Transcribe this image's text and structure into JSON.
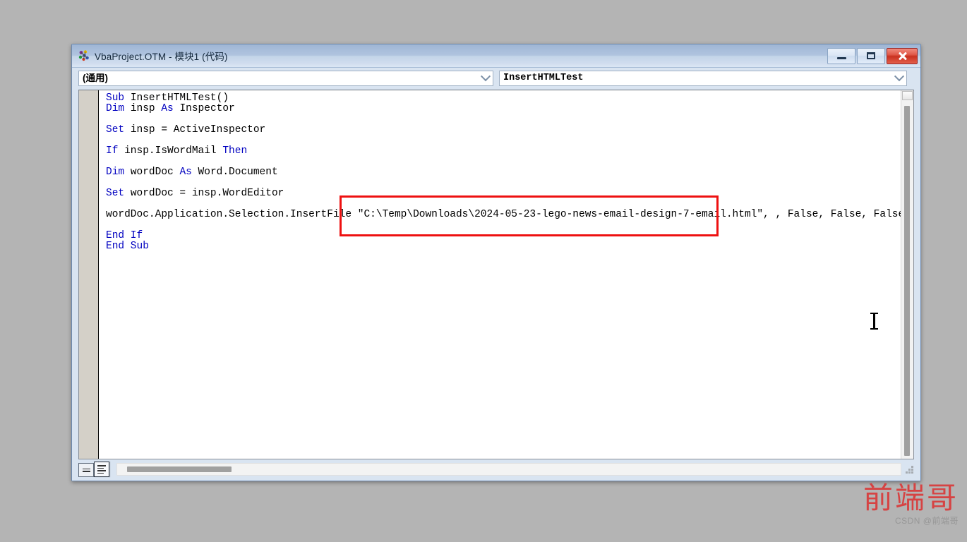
{
  "window": {
    "title": "VbaProject.OTM - 模块1 (代码)",
    "icon": "vba-project-icon",
    "buttons": {
      "minimize": "minimize-icon",
      "maximize": "maximize-icon",
      "close": "close-icon"
    }
  },
  "toolbars": {
    "object_combo": {
      "value": "(通用)",
      "arrow": "chevron-down-icon"
    },
    "procedure_combo": {
      "value": "InsertHTMLTest",
      "arrow": "chevron-down-icon"
    }
  },
  "code": {
    "lines": [
      [
        {
          "t": "Sub ",
          "k": true
        },
        {
          "t": "InsertHTMLTest()",
          "k": false
        }
      ],
      [
        {
          "t": "Dim ",
          "k": true
        },
        {
          "t": "insp ",
          "k": false
        },
        {
          "t": "As ",
          "k": true
        },
        {
          "t": "Inspector",
          "k": false
        }
      ],
      [],
      [
        {
          "t": "Set ",
          "k": true
        },
        {
          "t": "insp = ActiveInspector",
          "k": false
        }
      ],
      [],
      [
        {
          "t": "If ",
          "k": true
        },
        {
          "t": "insp.IsWordMail ",
          "k": false
        },
        {
          "t": "Then",
          "k": true
        }
      ],
      [],
      [
        {
          "t": "Dim ",
          "k": true
        },
        {
          "t": "wordDoc ",
          "k": false
        },
        {
          "t": "As ",
          "k": true
        },
        {
          "t": "Word.Document",
          "k": false
        }
      ],
      [],
      [
        {
          "t": "Set ",
          "k": true
        },
        {
          "t": "wordDoc = insp.WordEditor",
          "k": false
        }
      ],
      [],
      [
        {
          "t": "wordDoc.Application.Selection.InsertFile \"C:\\Temp\\Downloads\\2024-05-23-lego-news-email-design-7-email.html\", , False, False, False",
          "k": false
        }
      ],
      [],
      [
        {
          "t": "End If",
          "k": true
        }
      ],
      [
        {
          "t": "End Sub",
          "k": true
        }
      ]
    ],
    "highlighted_string": "C:\\Temp\\Downloads\\2024-05-23-lego-news-email-design-7-email.html",
    "annotation_color": "#ee1111"
  },
  "statusbar": {
    "procedure_view_button": "procedure-view-icon",
    "full_module_view_button": "full-module-view-icon",
    "horizontal_scrollbar": "h-scrollbar",
    "resize_grip": "resize-grip-icon"
  },
  "watermark": {
    "main": "前端哥",
    "sub": "CSDN @前端哥"
  },
  "cursor": {
    "type": "text-ibeam-cursor"
  }
}
